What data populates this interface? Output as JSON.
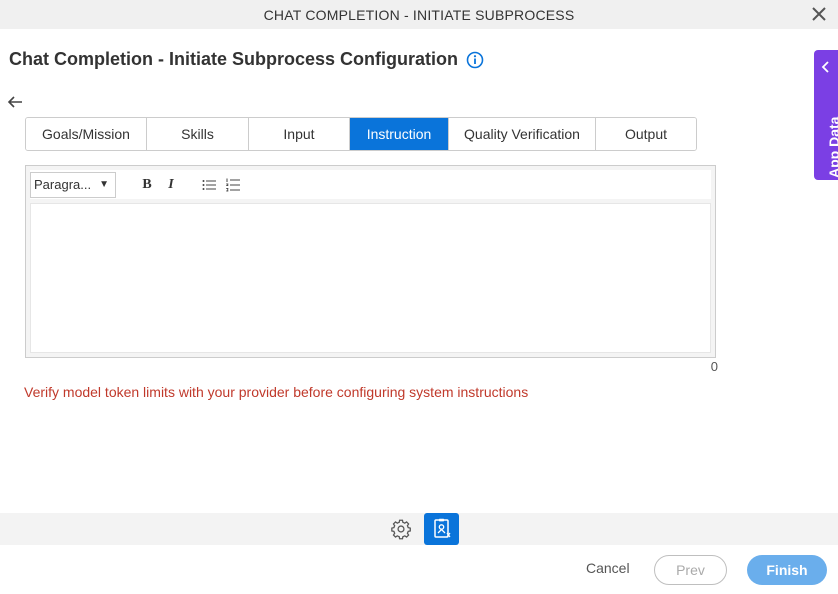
{
  "window": {
    "title": "CHAT COMPLETION - INITIATE SUBPROCESS",
    "close_icon": "close-icon"
  },
  "header": {
    "title": "Chat Completion - Initiate Subprocess Configuration",
    "info_icon": "info-icon"
  },
  "tabs": [
    {
      "label": "Goals/Mission",
      "active": false
    },
    {
      "label": "Skills",
      "active": false
    },
    {
      "label": "Input",
      "active": false
    },
    {
      "label": "Instruction",
      "active": true
    },
    {
      "label": "Quality Verification",
      "active": false
    },
    {
      "label": "Output",
      "active": false
    }
  ],
  "editor": {
    "format_select": "Paragra...",
    "bold_label": "B",
    "italic_label": "I",
    "content": "",
    "char_count": "0"
  },
  "warning": "Verify model token limits with your provider before configuring system instructions",
  "side_panel": {
    "label": "App Data"
  },
  "footer": {
    "cancel_label": "Cancel",
    "prev_label": "Prev",
    "finish_label": "Finish"
  },
  "colors": {
    "accent": "#0a74da",
    "side_panel": "#7b3fe4",
    "warning": "#c0392b",
    "finish": "#6aaeec"
  }
}
